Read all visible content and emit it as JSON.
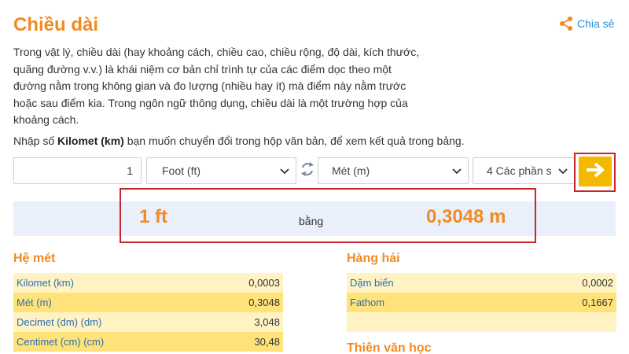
{
  "page": {
    "title": "Chiều dài",
    "share_label": "Chia sẻ",
    "description": "Trong vật lý, chiều dài (hay khoảng cách, chiều cao, chiều rộng, độ dài, kích thước, quãng đường v.v.) là khái niệm cơ bản chỉ trình tự của các điểm dọc theo một đường nằm trong không gian và đo lượng (nhiều hay ít) mà điểm này nằm trước hoặc sau điểm kia. Trong ngôn ngữ thông dụng, chiều dài là một trường hợp của khoảng cách.",
    "instruction_prefix": "Nhập số",
    "instruction_unit": "Kilomet (km)",
    "instruction_suffix": "bạn muốn chuyển đổi trong hộp văn bản, để xem kết quả trong bảng."
  },
  "converter": {
    "input_value": "1",
    "from_unit": "Foot (ft)",
    "to_unit": "Mét (m)",
    "decimals": "4 Các phần s"
  },
  "result": {
    "left": "1 ft",
    "middle": "bằng",
    "right": "0,3048 m"
  },
  "sections": {
    "metric_title": "Hệ mét",
    "nautical_title": "Hàng hải",
    "astro_title": "Thiên văn học"
  },
  "metric_rows": [
    {
      "name": "Kilomet (km)",
      "value": "0,0003"
    },
    {
      "name": "Mét (m)",
      "value": "0,3048"
    },
    {
      "name": "Decimet (dm) (dm)",
      "value": "3,048"
    },
    {
      "name": "Centimet (cm) (cm)",
      "value": "30,48"
    }
  ],
  "nautical_rows": [
    {
      "name": "Dặm biển",
      "value": "0,0002"
    },
    {
      "name": "Fathom",
      "value": "0,1667"
    },
    {
      "name": "",
      "value": ""
    }
  ],
  "colors": {
    "accent": "#f08a24",
    "link": "#2a8fd8",
    "highlight_frame": "#c8252c",
    "go_button": "#f5b800"
  },
  "icons": {
    "share": "share-icon",
    "swap": "swap-icon",
    "go": "arrow-right-icon",
    "dropdown": "chevron-down-icon"
  }
}
